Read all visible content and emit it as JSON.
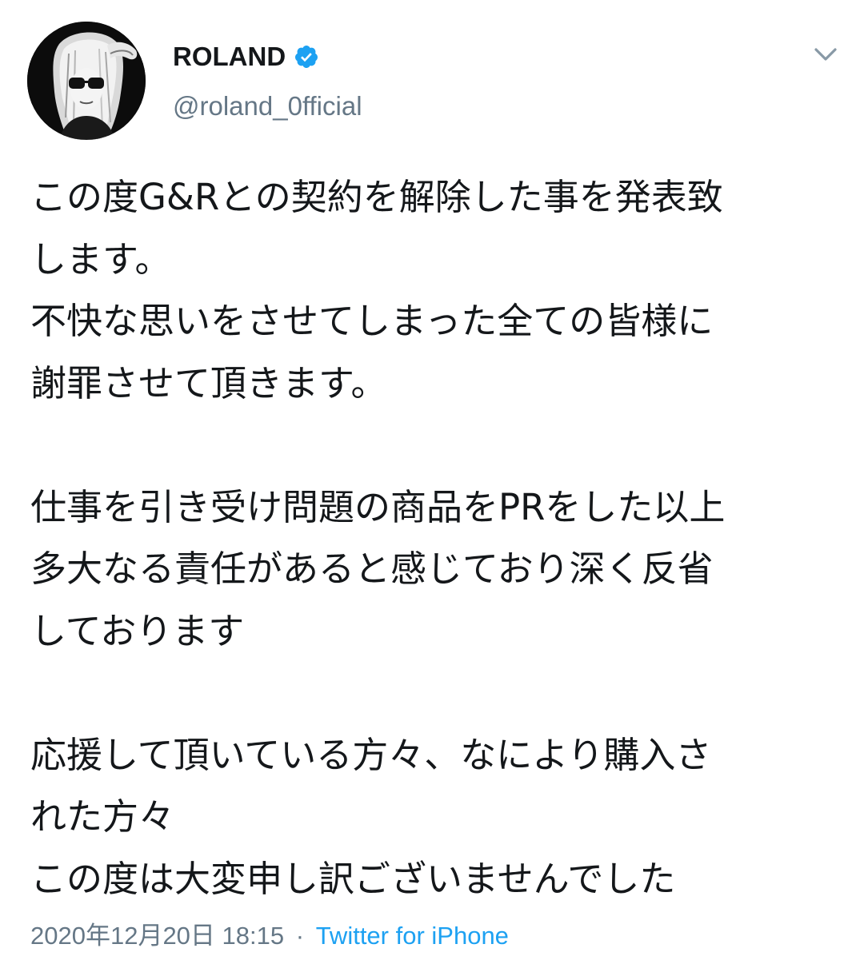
{
  "tweet": {
    "display_name": "ROLAND",
    "handle": "@roland_0fficial",
    "verified": true,
    "text_lines": [
      "この度G&Rとの契約を解除した事を発表致",
      "します。",
      "不快な思いをさせてしまった全ての皆様に",
      "謝罪させて頂きます。",
      "",
      "仕事を引き受け問題の商品をPRをした以上",
      "多大なる責任があると感じており深く反省",
      "しております",
      "",
      "応援して頂いている方々、なにより購入さ",
      "れた方々",
      "この度は大変申し訳ございませんでした"
    ],
    "timestamp": "2020年12月20日 18:15",
    "separator": "·",
    "source": "Twitter for iPhone"
  },
  "icons": {
    "verified": "verified-badge-icon",
    "caret": "chevron-down-icon",
    "avatar": "profile-avatar"
  },
  "colors": {
    "text": "#14171a",
    "secondary": "#657786",
    "link": "#1da1f2",
    "verified": "#1da1f2"
  }
}
